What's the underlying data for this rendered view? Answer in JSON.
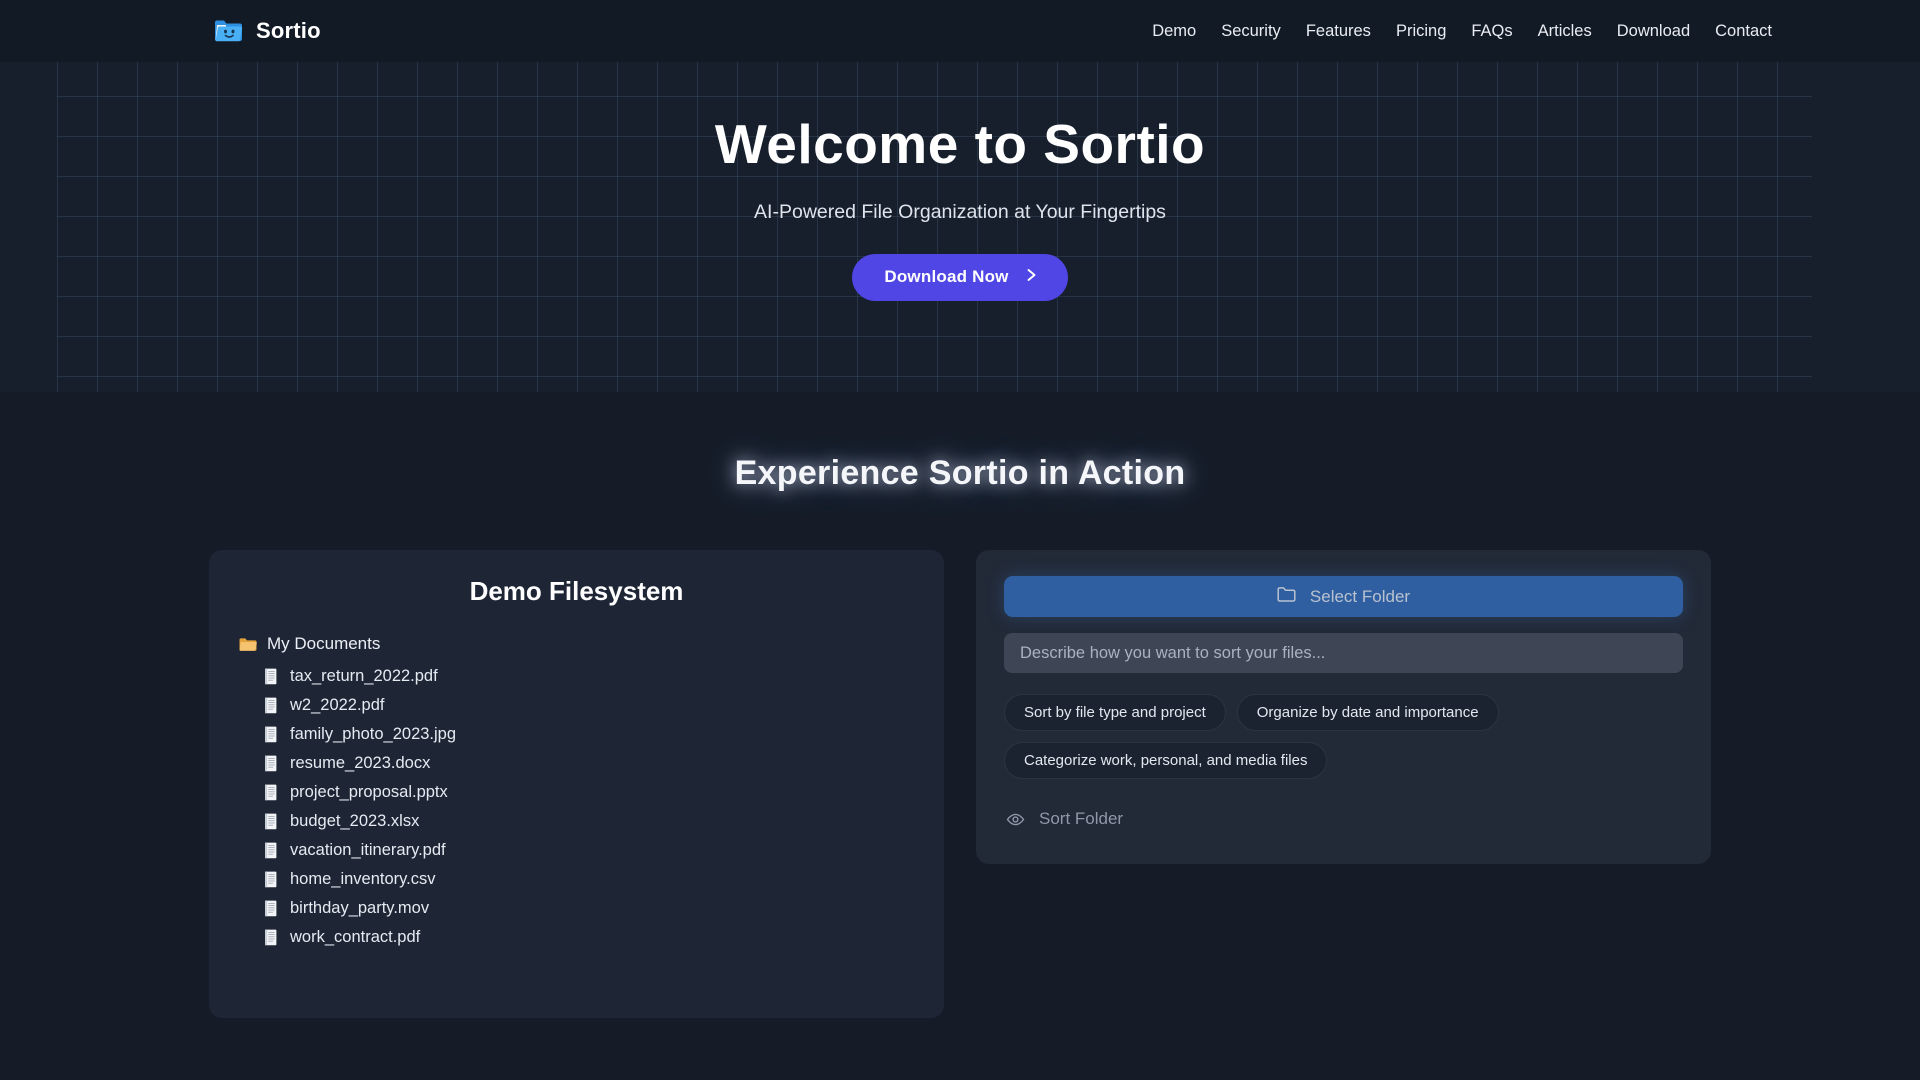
{
  "navbar": {
    "brand_name": "Sortio",
    "brand_icon": "smiling-folder-logo-icon",
    "links": [
      {
        "label": "Demo"
      },
      {
        "label": "Security"
      },
      {
        "label": "Features"
      },
      {
        "label": "Pricing"
      },
      {
        "label": "FAQs"
      },
      {
        "label": "Articles"
      },
      {
        "label": "Download"
      },
      {
        "label": "Contact"
      }
    ]
  },
  "hero": {
    "title": "Welcome to Sortio",
    "subtitle": "AI-Powered File Organization at Your Fingertips",
    "cta_label": "Download Now",
    "cta_icon": "chevron-right-icon",
    "accent_color": "#4f46e5",
    "background_color": "#171f2d"
  },
  "demo": {
    "section_title": "Experience Sortio in Action",
    "filesystem": {
      "panel_title": "Demo Filesystem",
      "root_folder": {
        "name": "My Documents",
        "icon": "folder-icon"
      },
      "files": [
        {
          "name": "tax_return_2022.pdf",
          "icon": "file-icon"
        },
        {
          "name": "w2_2022.pdf",
          "icon": "file-icon"
        },
        {
          "name": "family_photo_2023.jpg",
          "icon": "file-icon"
        },
        {
          "name": "resume_2023.docx",
          "icon": "file-icon"
        },
        {
          "name": "project_proposal.pptx",
          "icon": "file-icon"
        },
        {
          "name": "budget_2023.xlsx",
          "icon": "file-icon"
        },
        {
          "name": "vacation_itinerary.pdf",
          "icon": "file-icon"
        },
        {
          "name": "home_inventory.csv",
          "icon": "file-icon"
        },
        {
          "name": "birthday_party.mov",
          "icon": "file-icon"
        },
        {
          "name": "work_contract.pdf",
          "icon": "file-icon"
        }
      ]
    },
    "sorter": {
      "select_folder_label": "Select Folder",
      "select_folder_icon": "folder-outline-icon",
      "select_folder_color": "#2f5fa0",
      "prompt_value": "",
      "prompt_placeholder": "Describe how you want to sort your files...",
      "suggestions": [
        {
          "label": "Sort by file type and project"
        },
        {
          "label": "Organize by date and importance"
        },
        {
          "label": "Categorize work, personal, and media files"
        }
      ],
      "sort_button_label": "Sort Folder",
      "sort_button_icon": "eye-icon"
    }
  }
}
